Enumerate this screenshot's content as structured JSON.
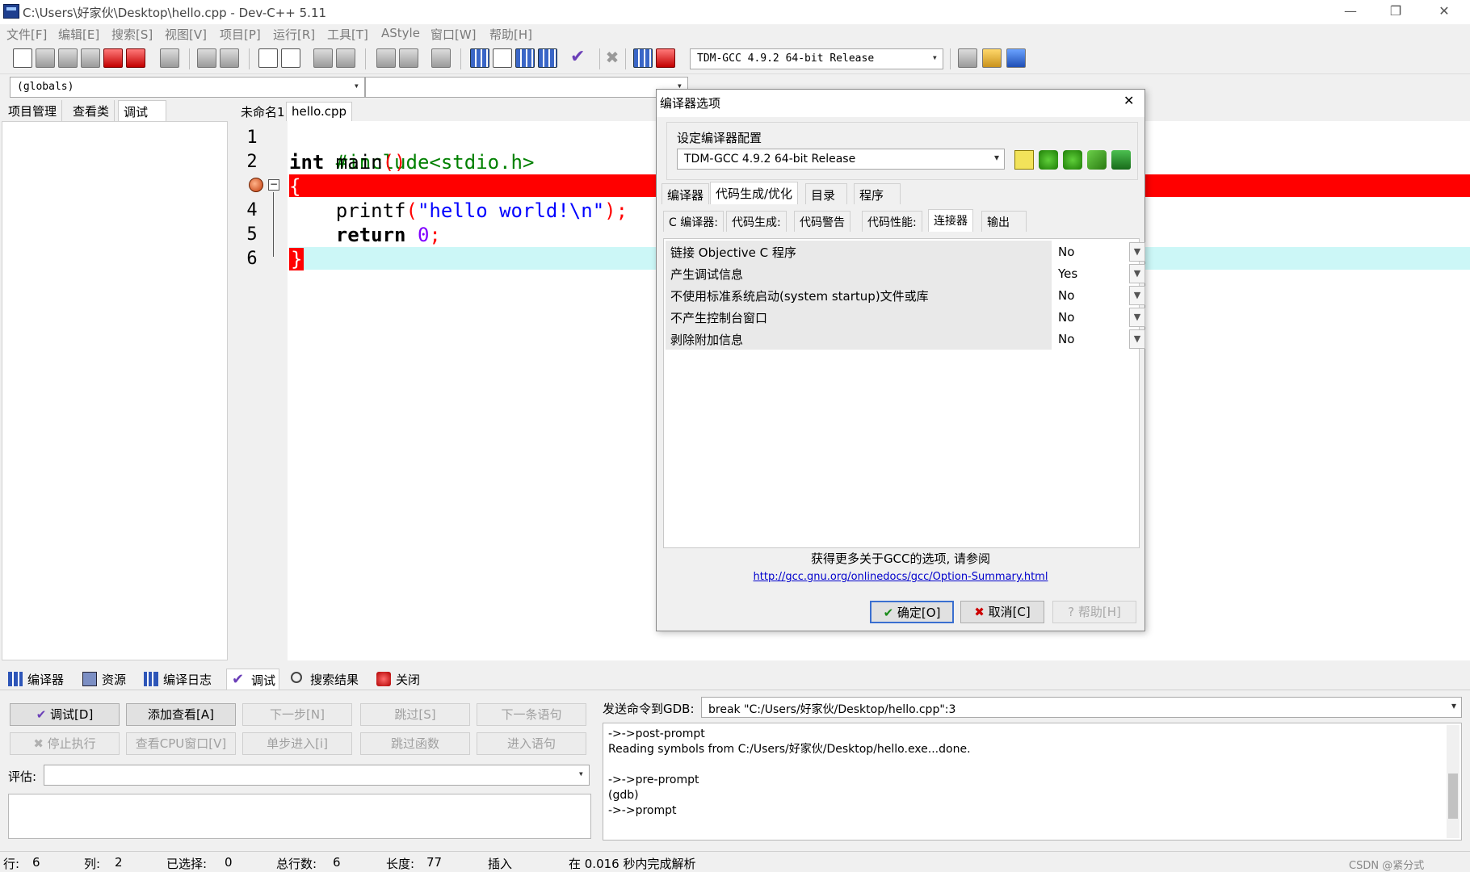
{
  "window": {
    "title": "C:\\Users\\好家伙\\Desktop\\hello.cpp - Dev-C++ 5.11",
    "minimize": "—",
    "restore": "❐",
    "close": "✕"
  },
  "menu": [
    "文件[F]",
    "编辑[E]",
    "搜索[S]",
    "视图[V]",
    "项目[P]",
    "运行[R]",
    "工具[T]",
    "AStyle",
    "窗口[W]",
    "帮助[H]"
  ],
  "toolbar": {
    "compiler_select": "TDM-GCC 4.9.2 64-bit Release"
  },
  "globals": {
    "value": "(globals)"
  },
  "left_tabs": [
    "项目管理",
    "查看类",
    "调试"
  ],
  "editor": {
    "tabs": [
      "未命名1",
      "hello.cpp"
    ],
    "line_numbers": [
      "1",
      "2",
      "3",
      "4",
      "5",
      "6"
    ],
    "code": {
      "l1": "#include<stdio.h>",
      "l2_kw": "int",
      "l2_id": " main",
      "l2_par": "()",
      "l3": "{",
      "l4_id": "    printf",
      "l4_p1": "(",
      "l4_str": "\"hello world!\\n\"",
      "l4_p2": ");",
      "l5_kw": "    return",
      "l5_num": " 0",
      "l5_end": ";",
      "l6": "}"
    }
  },
  "dialog": {
    "title": "编译器选项",
    "close": "✕",
    "config_label": "设定编译器配置",
    "config_value": "TDM-GCC 4.9.2 64-bit Release",
    "main_tabs": [
      "编译器",
      "代码生成/优化",
      "目录",
      "程序"
    ],
    "sub_tabs": [
      "C 编译器:",
      "代码生成:",
      "代码警告",
      "代码性能:",
      "连接器",
      "输出"
    ],
    "options": [
      {
        "label": "链接 Objective C 程序",
        "value": "No"
      },
      {
        "label": "产生调试信息",
        "value": "Yes"
      },
      {
        "label": "不使用标准系统启动(system startup)文件或库",
        "value": "No"
      },
      {
        "label": "不产生控制台窗口",
        "value": "No"
      },
      {
        "label": "剥除附加信息",
        "value": "No"
      }
    ],
    "more_info": "获得更多关于GCC的选项, 请参阅",
    "link": "http://gcc.gnu.org/onlinedocs/gcc/Option-Summary.html",
    "ok": "确定[O]",
    "cancel": "取消[C]",
    "help": "帮助[H]"
  },
  "bottom_tabs": [
    "编译器",
    "资源",
    "编译日志",
    "调试",
    "搜索结果",
    "关闭"
  ],
  "debug": {
    "buttons_row1": [
      "调试[D]",
      "添加查看[A]",
      "下一步[N]",
      "跳过[S]",
      "下一条语句"
    ],
    "buttons_row2": [
      "停止执行",
      "查看CPU窗口[V]",
      "单步进入[i]",
      "跳过函数",
      "进入语句"
    ],
    "eval_label": "评估:",
    "gdb_label": "发送命令到GDB:",
    "gdb_command": "break \"C:/Users/好家伙/Desktop/hello.cpp\":3",
    "output": [
      "->->post-prompt",
      "Reading symbols from C:/Users/好家伙/Desktop/hello.exe...done.",
      "",
      "->->pre-prompt",
      "(gdb)",
      "->->prompt"
    ]
  },
  "status": {
    "row_label": "行:",
    "row": "6",
    "col_label": "列:",
    "col": "2",
    "sel_label": "已选择:",
    "sel": "0",
    "lines_label": "总行数:",
    "lines": "6",
    "len_label": "长度:",
    "len": "77",
    "mode": "插入",
    "parse": "在 0.016 秒内完成解析",
    "watermark": "CSDN @紧分式"
  },
  "colors": {
    "breakpoint_line": "#ff0000",
    "current_line": "#ccf7f7",
    "link": "#0000cc"
  }
}
